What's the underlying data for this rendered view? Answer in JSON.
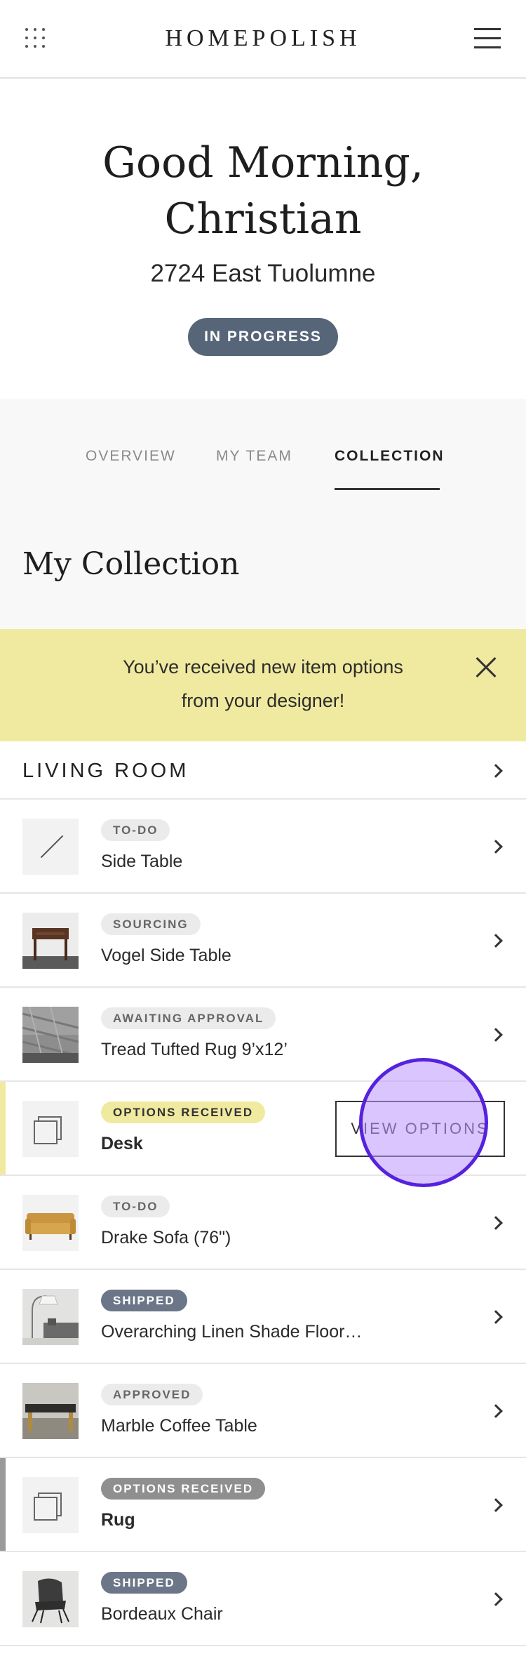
{
  "header": {
    "brand": "HOMEPOLISH",
    "grid_icon": "grid-icon",
    "menu_icon": "hamburger-menu-icon"
  },
  "hero": {
    "greeting_line1": "Good Morning,",
    "greeting_line2": "Christian",
    "address": "2724 East Tuolumne",
    "status": "IN PROGRESS"
  },
  "tabs": [
    {
      "label": "OVERVIEW",
      "active": false
    },
    {
      "label": "MY TEAM",
      "active": false
    },
    {
      "label": "COLLECTION",
      "active": true
    }
  ],
  "collection_title": "My Collection",
  "banner": {
    "line1": "You’ve received new item options",
    "line2": "from your designer!",
    "color": "#f0eaa0"
  },
  "room": {
    "name": "LIVING ROOM"
  },
  "items": [
    {
      "status": "TO-DO",
      "name": "Side Table",
      "thumb": "placeholder-slash"
    },
    {
      "status": "SOURCING",
      "name": "Vogel Side Table",
      "thumb": "side-table-photo"
    },
    {
      "status": "AWAITING APPROVAL",
      "name": "Tread Tufted Rug 9’x12’",
      "thumb": "rug-photo"
    },
    {
      "status": "OPTIONS RECEIVED",
      "name": "Desk",
      "thumb": "stack-icon",
      "action": "VIEW OPTIONS"
    },
    {
      "status": "TO-DO",
      "name": "Drake Sofa (76\")",
      "thumb": "sofa-photo"
    },
    {
      "status": "SHIPPED",
      "name": "Overarching Linen Shade Floor…",
      "thumb": "floor-lamp-photo"
    },
    {
      "status": "APPROVED",
      "name": "Marble Coffee Table",
      "thumb": "coffee-table-photo"
    },
    {
      "status": "OPTIONS RECEIVED",
      "name": "Rug",
      "thumb": "stack-icon"
    },
    {
      "status": "SHIPPED",
      "name": "Bordeaux Chair",
      "thumb": "chair-photo"
    }
  ],
  "colors": {
    "status_pill": "#566577",
    "badge_dark": "#6b7788",
    "badge_yellow": "#f0eaa0",
    "badge_gray": "#8f8f8f",
    "touch_indicator": "#5522dd"
  }
}
